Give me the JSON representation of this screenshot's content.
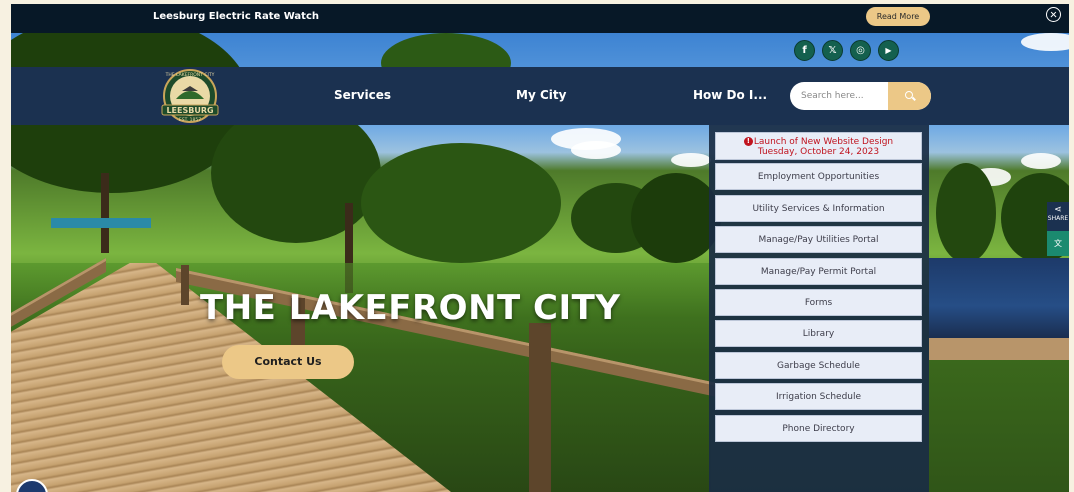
{
  "alert": {
    "text": "Leesburg Electric Rate Watch",
    "read_more": "Read More"
  },
  "social": [
    {
      "name": "facebook",
      "glyph": "f"
    },
    {
      "name": "x",
      "glyph": "𝕏"
    },
    {
      "name": "instagram",
      "glyph": "◎"
    },
    {
      "name": "youtube",
      "glyph": "▶"
    }
  ],
  "logo": {
    "top_text": "THE LAKEFRONT CITY",
    "name": "LEESBURG",
    "est": "EST. 1857"
  },
  "nav": {
    "items": [
      "Services",
      "My City",
      "How Do I..."
    ]
  },
  "search": {
    "placeholder": "Search here..."
  },
  "hero": {
    "title": "THE LAKEFRONT CITY",
    "contact_label": "Contact Us"
  },
  "quick_links": {
    "announcement_line1": "Launch of New Website Design",
    "announcement_line2": "Tuesday, October 24, 2023",
    "items": [
      "Employment Opportunities",
      "Utility Services & Information",
      "Manage/Pay Utilities Portal",
      "Manage/Pay Permit Portal",
      "Forms",
      "Library",
      "Garbage Schedule",
      "Irrigation Schedule",
      "Phone Directory"
    ]
  },
  "side": {
    "share_label": "SHARE"
  },
  "colors": {
    "nav_bg": "#1b3150",
    "accent_gold": "#ecc887",
    "alert_bg": "#071827",
    "social_green": "#14604e",
    "announcement_red": "#c0141f"
  }
}
